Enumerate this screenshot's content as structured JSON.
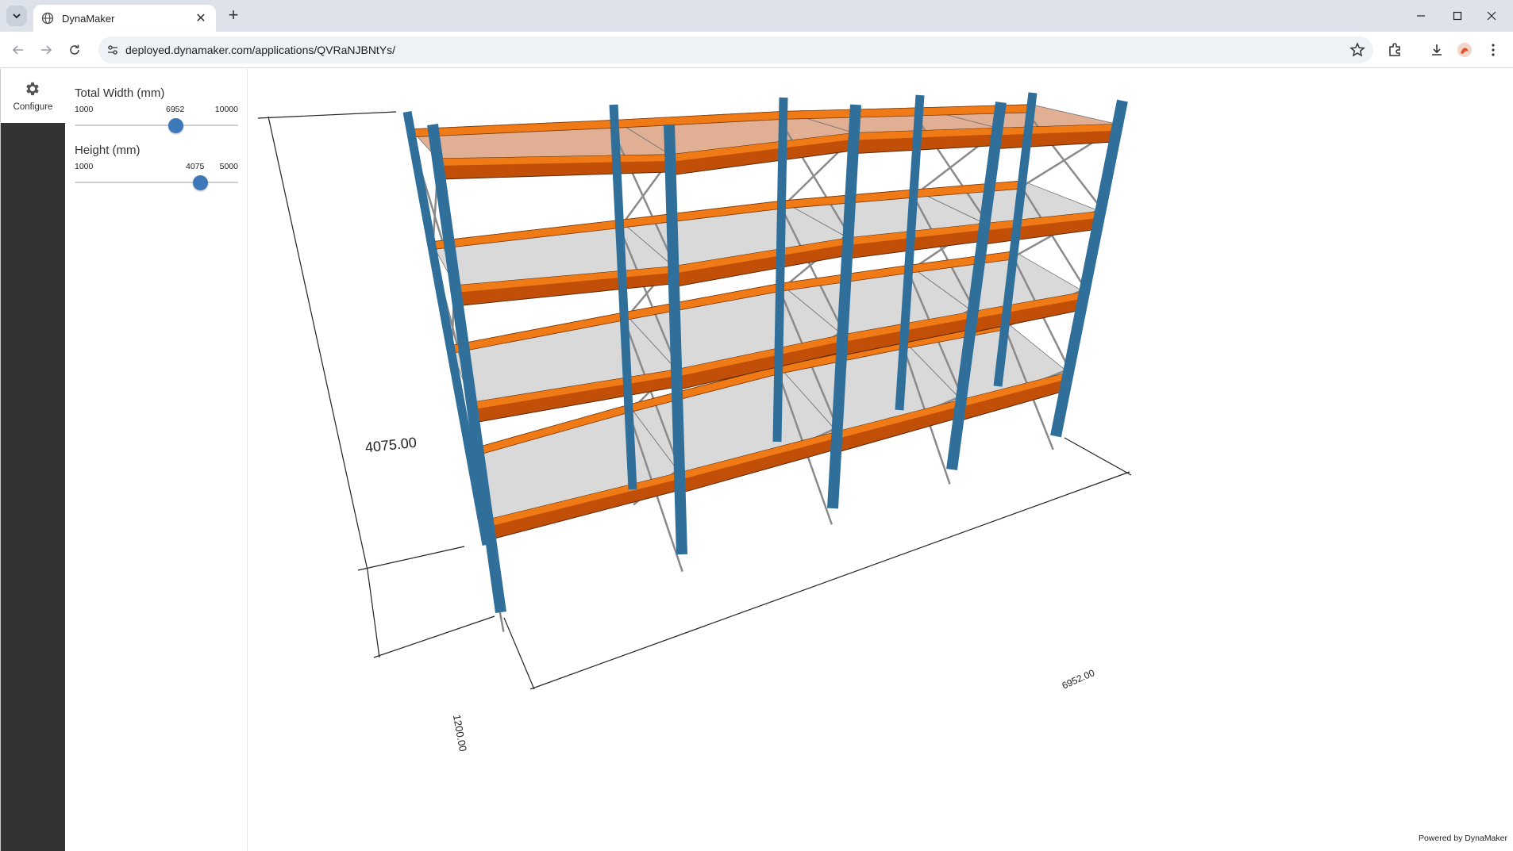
{
  "browser": {
    "tab_title": "DynaMaker",
    "url": "deployed.dynamaker.com/applications/QVRaNJBNtYs/"
  },
  "rail": {
    "configure_label": "Configure"
  },
  "parameters": [
    {
      "label": "Total Width (mm)",
      "min": 1000,
      "max": 10000,
      "value": 6952,
      "min_label": "1000",
      "max_label": "10000",
      "value_label": "6952"
    },
    {
      "label": "Height (mm)",
      "min": 1000,
      "max": 5000,
      "value": 4075,
      "min_label": "1000",
      "max_label": "5000",
      "value_label": "4075"
    }
  ],
  "model": {
    "dim_height": "4075.00",
    "dim_depth": "1200.00",
    "dim_width": "6952.00",
    "colors": {
      "upright": "#2f6f9a",
      "beam": "#f07a16",
      "beam_dark": "#c24f08",
      "shelf": "rgba(170,170,170,0.45)"
    }
  },
  "footer": {
    "powered_by": "Powered by DynaMaker"
  }
}
